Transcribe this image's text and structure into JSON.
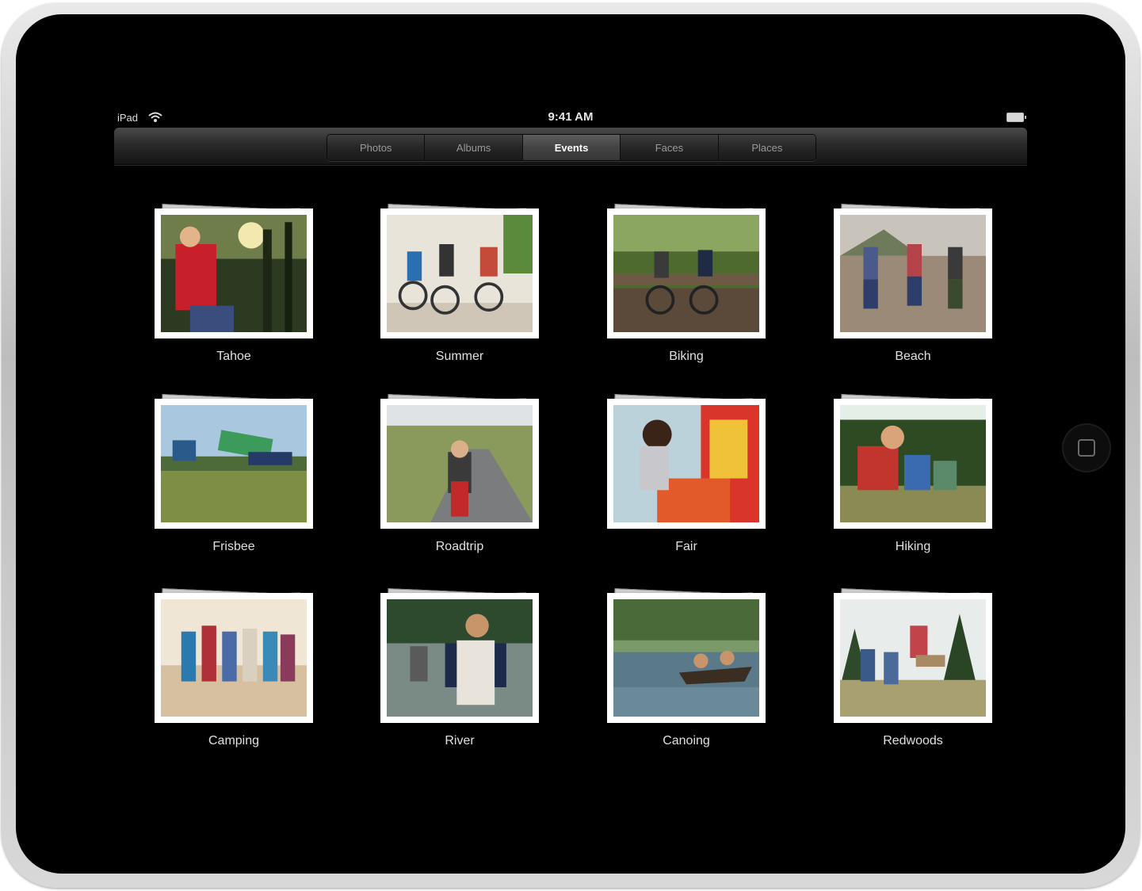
{
  "statusbar": {
    "carrier": "iPad",
    "time": "9:41 AM"
  },
  "tabs": [
    {
      "label": "Photos",
      "active": false
    },
    {
      "label": "Albums",
      "active": false
    },
    {
      "label": "Events",
      "active": true
    },
    {
      "label": "Faces",
      "active": false
    },
    {
      "label": "Places",
      "active": false
    }
  ],
  "events": [
    {
      "name": "Tahoe",
      "icon": "photo-stack"
    },
    {
      "name": "Summer",
      "icon": "photo-stack"
    },
    {
      "name": "Biking",
      "icon": "photo-stack"
    },
    {
      "name": "Beach",
      "icon": "photo-stack"
    },
    {
      "name": "Frisbee",
      "icon": "photo-stack"
    },
    {
      "name": "Roadtrip",
      "icon": "photo-stack"
    },
    {
      "name": "Fair",
      "icon": "photo-stack"
    },
    {
      "name": "Hiking",
      "icon": "photo-stack"
    },
    {
      "name": "Camping",
      "icon": "photo-stack"
    },
    {
      "name": "River",
      "icon": "photo-stack"
    },
    {
      "name": "Canoing",
      "icon": "photo-stack"
    },
    {
      "name": "Redwoods",
      "icon": "photo-stack"
    }
  ],
  "colors": {
    "screen_bg": "#000000",
    "label_text": "#e0e0e0",
    "active_tab_text": "#ffffff",
    "inactive_tab_text": "#9a9a9a"
  }
}
